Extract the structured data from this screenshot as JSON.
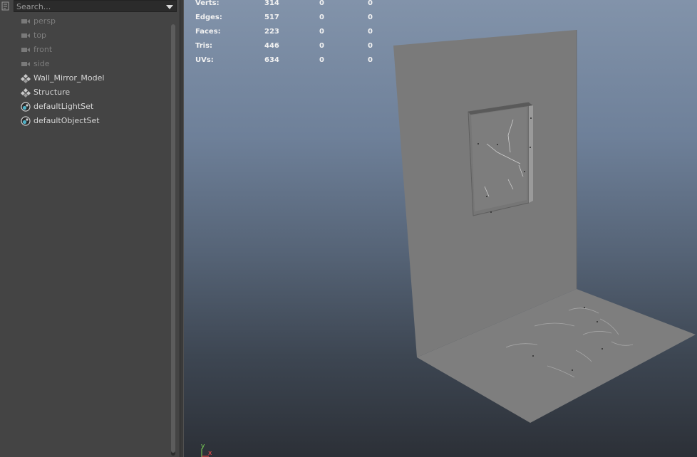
{
  "outliner": {
    "search_placeholder": "Search...",
    "items": [
      {
        "label": "persp",
        "icon": "camera-icon",
        "hidden": true
      },
      {
        "label": "top",
        "icon": "camera-icon",
        "hidden": true
      },
      {
        "label": "front",
        "icon": "camera-icon",
        "hidden": true
      },
      {
        "label": "side",
        "icon": "camera-icon",
        "hidden": true
      },
      {
        "label": "Wall_Mirror_Model",
        "icon": "group-transform-icon",
        "hidden": false
      },
      {
        "label": "Structure",
        "icon": "group-transform-icon",
        "hidden": false
      },
      {
        "label": "defaultLightSet",
        "icon": "set-icon",
        "hidden": false
      },
      {
        "label": "defaultObjectSet",
        "icon": "set-icon",
        "hidden": false
      }
    ]
  },
  "hud": {
    "rows": [
      {
        "label": "Verts:",
        "v1": "314",
        "v2": "0",
        "v3": "0"
      },
      {
        "label": "Edges:",
        "v1": "517",
        "v2": "0",
        "v3": "0"
      },
      {
        "label": "Faces:",
        "v1": "223",
        "v2": "0",
        "v3": "0"
      },
      {
        "label": "Tris:",
        "v1": "446",
        "v2": "0",
        "v3": "0"
      },
      {
        "label": "UVs:",
        "v1": "634",
        "v2": "0",
        "v3": "0"
      }
    ]
  },
  "axis": {
    "y_label": "y",
    "x_label": "x"
  },
  "colors": {
    "panel_bg": "#444444",
    "text": "#d6d6d6",
    "text_dim": "#7e7e7e",
    "viewport_top": "#8293aa",
    "viewport_bottom": "#2c3037",
    "model_gray": "#7a7a7a"
  }
}
